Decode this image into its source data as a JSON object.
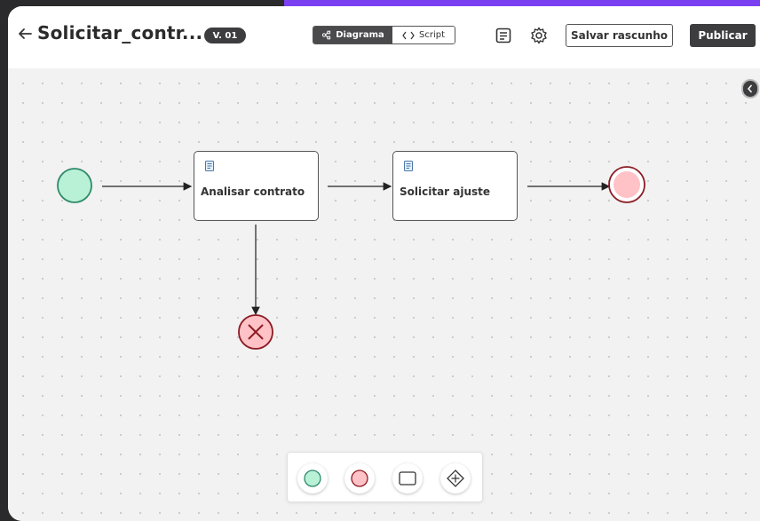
{
  "header": {
    "title": "Solicitar_contr...",
    "version": "V. 01",
    "view_toggle": [
      {
        "label": "Diagrama",
        "icon": "diagram-icon",
        "active": true
      },
      {
        "label": "Script",
        "icon": "code-icon",
        "active": false
      }
    ],
    "save_draft_label": "Salvar rascunho",
    "publish_label": "Publicar"
  },
  "diagram": {
    "start_event": {
      "icon": "start-event-circle",
      "fill": "#b9f1d6",
      "stroke": "#2f8a6b"
    },
    "tasks": [
      {
        "label": "Analisar contrato",
        "icon": "document-icon"
      },
      {
        "label": "Solicitar ajuste",
        "icon": "document-icon"
      }
    ],
    "end_event": {
      "icon": "end-event-circle",
      "fill": "#ffc2c6",
      "stroke": "#8b1c24"
    },
    "error_end_event": {
      "icon": "error-x-circle",
      "fill": "#ffc2c6",
      "stroke": "#8b1c24"
    }
  },
  "palette": [
    {
      "name": "start-event-tool",
      "icon": "green-circle-icon"
    },
    {
      "name": "end-event-tool",
      "icon": "red-circle-icon"
    },
    {
      "name": "task-tool",
      "icon": "rectangle-icon"
    },
    {
      "name": "gateway-tool",
      "icon": "diamond-plus-icon"
    }
  ],
  "colors": {
    "accent": "#7b3ff2",
    "dark": "#3d3d3f",
    "start_fill": "#b9f1d6",
    "end_fill": "#ffc2c6"
  }
}
